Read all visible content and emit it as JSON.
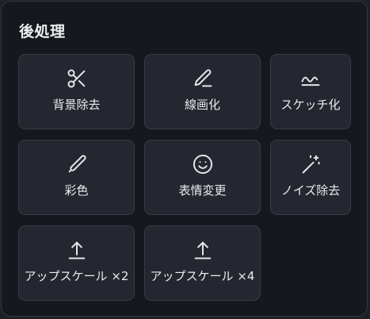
{
  "panel": {
    "title": "後処理"
  },
  "tools": [
    {
      "label": "背景除去",
      "icon": "scissors-icon"
    },
    {
      "label": "線画化",
      "icon": "pen-line-icon"
    },
    {
      "label": "スケッチ化",
      "icon": "squiggle-icon"
    },
    {
      "label": "彩色",
      "icon": "brush-icon"
    },
    {
      "label": "表情変更",
      "icon": "smile-icon"
    },
    {
      "label": "ノイズ除去",
      "icon": "magic-wand-icon"
    },
    {
      "label": "アップスケール ×2",
      "icon": "upload-icon"
    },
    {
      "label": "アップスケール ×4",
      "icon": "upload-icon"
    }
  ],
  "colors": {
    "panel_bg": "#16181d",
    "tile_bg": "#24272f",
    "tile_border": "#383c46",
    "text": "#e9ebef"
  }
}
